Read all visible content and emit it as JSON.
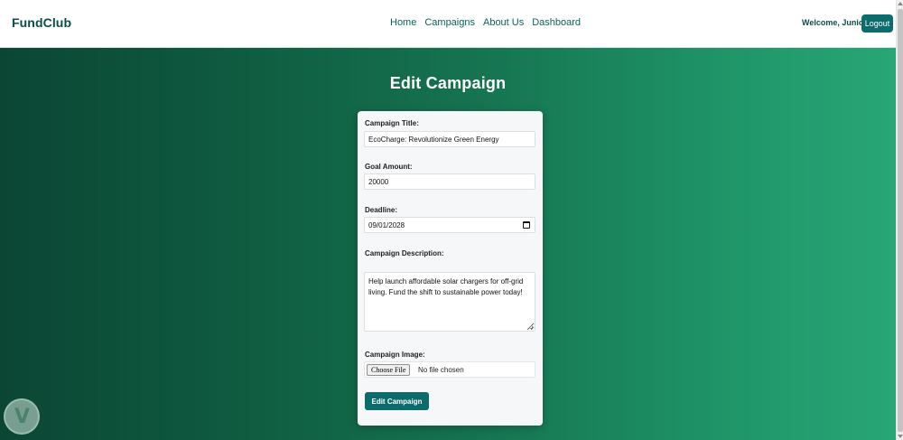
{
  "navbar": {
    "brand": "FundClub",
    "links": [
      "Home",
      "Campaigns",
      "About Us",
      "Dashboard"
    ],
    "welcome": "Welcome, Junior",
    "logout_label": "Logout"
  },
  "page": {
    "title": "Edit Campaign"
  },
  "form": {
    "title_label": "Campaign Title:",
    "title_value": "EcoCharge: Revolutionize Green Energy",
    "goal_label": "Goal Amount:",
    "goal_value": "20000",
    "deadline_label": "Deadline:",
    "deadline_value": "09/01/2028",
    "description_label": "Campaign Description:",
    "description_value": "Help launch affordable solar chargers for off-grid living. Fund the shift to sustainable power today!",
    "image_label": "Campaign Image:",
    "choose_file_label": "Choose File",
    "no_file_text": "No file chosen",
    "submit_label": "Edit Campaign"
  },
  "colors": {
    "accent": "#0d6b6b",
    "gradient_start": "#0b4634",
    "gradient_end": "#28a676"
  },
  "icons": {
    "calendar": "calendar-icon",
    "watermark": "shield-logo-icon"
  }
}
